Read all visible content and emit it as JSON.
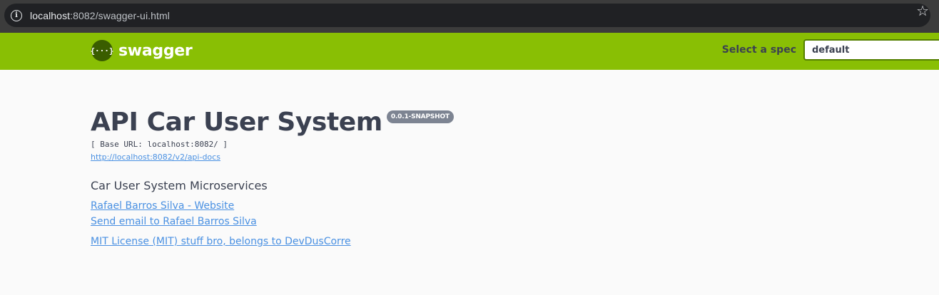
{
  "browser": {
    "url_host": "localhost",
    "url_path": ":8082/swagger-ui.html",
    "info_icon": "info-icon",
    "bookmark_icon": "star-icon"
  },
  "topbar": {
    "logo_glyph": "{···}",
    "logo_text": "swagger",
    "spec_label": "Select a spec",
    "spec_value": "default",
    "colors": {
      "background": "#89bf04",
      "logo_circle": "#3a5d00"
    }
  },
  "info": {
    "title": "API Car User System",
    "version": "0.0.1-SNAPSHOT",
    "base_url": "[ Base URL: localhost:8082/ ]",
    "api_docs_link": "http://localhost:8082/v2/api-docs",
    "description": "Car User System Microservices",
    "contact_website": "Rafael Barros Silva - Website",
    "contact_email": "Send email to Rafael Barros Silva",
    "license": "MIT License (MIT) stuff bro, belongs to DevDusCorre"
  }
}
